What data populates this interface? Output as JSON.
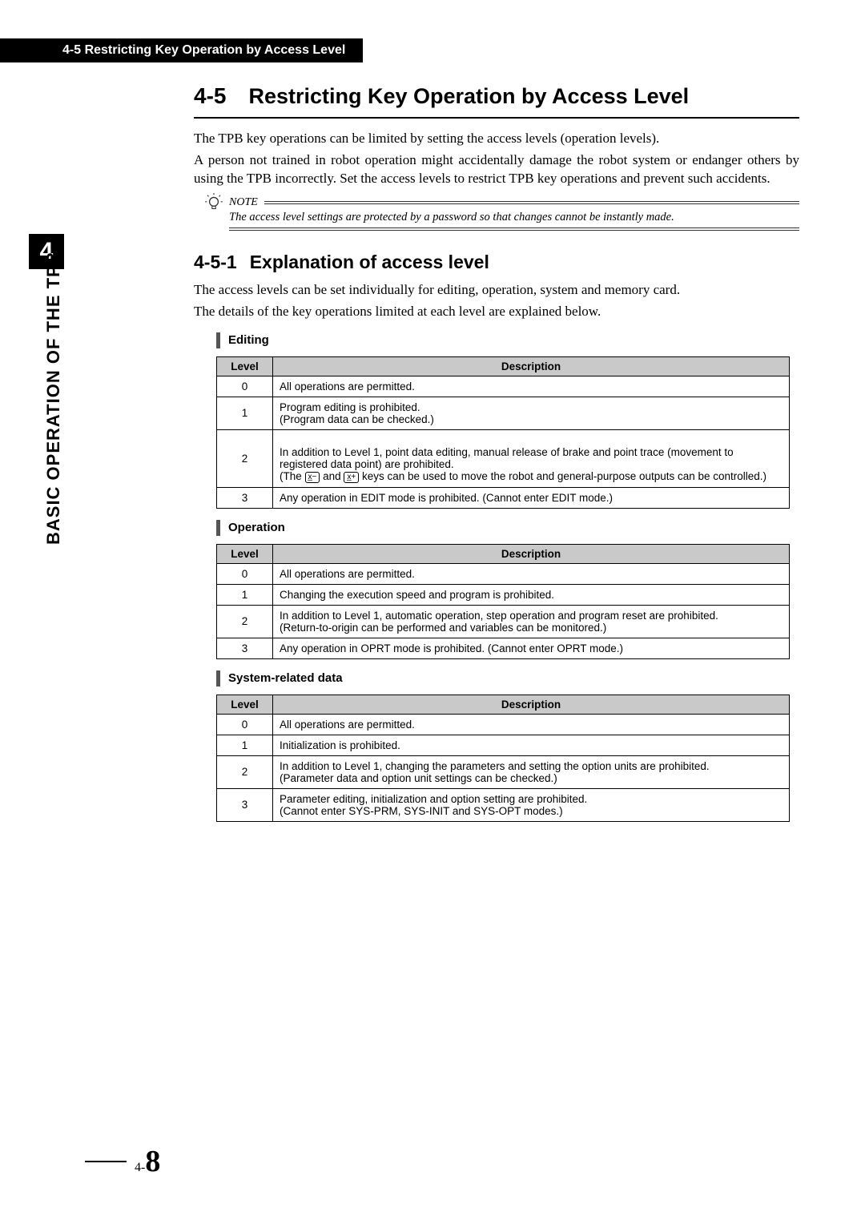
{
  "header": {
    "breadcrumb": "4-5 Restricting Key Operation by Access Level"
  },
  "chapter": {
    "number": "4",
    "side_label": "BASIC OPERATION OF THE TPB"
  },
  "heading": {
    "number": "4-5",
    "title": "Restricting Key Operation by Access Level"
  },
  "intro": {
    "p1": "The TPB key operations can be limited by setting the access levels (operation levels).",
    "p2": "A person not trained in robot operation might accidentally damage the robot system or endanger others by using the TPB incorrectly. Set the access levels to restrict TPB key operations and prevent such accidents."
  },
  "note": {
    "label": "NOTE",
    "text": "The access level settings are protected by a password so that changes cannot be instantly made."
  },
  "sub_heading": {
    "number": "4-5-1",
    "title": "Explanation of access level"
  },
  "sub_intro": {
    "p1": "The access levels can be set individually for editing, operation, system and memory card.",
    "p2": "The details of the key operations limited at each level are explained below."
  },
  "tables": {
    "level_header": "Level",
    "desc_header": "Description",
    "editing": {
      "title": "Editing",
      "rows": [
        {
          "level": "0",
          "desc": "All operations are permitted."
        },
        {
          "level": "1",
          "desc": "Program editing is prohibited.\n(Program data can be checked.)"
        },
        {
          "level": "2",
          "desc_pre": "In addition to Level 1, point data editing, manual release of brake and point trace (movement to registered data point) are prohibited.\n(The ",
          "key1": "x̲−",
          "desc_mid": " and ",
          "key2": "x̲+",
          "desc_post": " keys can be used to move the robot and general-purpose outputs can be controlled.)"
        },
        {
          "level": "3",
          "desc": "Any operation in EDIT mode is prohibited. (Cannot enter EDIT mode.)"
        }
      ]
    },
    "operation": {
      "title": "Operation",
      "rows": [
        {
          "level": "0",
          "desc": "All operations are permitted."
        },
        {
          "level": "1",
          "desc": "Changing the execution speed and program is prohibited."
        },
        {
          "level": "2",
          "desc": "In addition to Level 1, automatic operation, step operation and program reset are prohibited.\n(Return-to-origin can be performed and variables can be monitored.)"
        },
        {
          "level": "3",
          "desc": "Any operation in OPRT mode is prohibited. (Cannot enter OPRT mode.)"
        }
      ]
    },
    "system": {
      "title": "System-related data",
      "rows": [
        {
          "level": "0",
          "desc": "All operations are permitted."
        },
        {
          "level": "1",
          "desc": "Initialization is prohibited."
        },
        {
          "level": "2",
          "desc": "In addition to Level 1, changing the parameters and setting the option units are prohibited.\n(Parameter data and option unit settings can be checked.)"
        },
        {
          "level": "3",
          "desc": "Parameter editing, initialization and option setting are prohibited.\n(Cannot enter SYS-PRM, SYS-INIT and SYS-OPT modes.)"
        }
      ]
    }
  },
  "page_number": {
    "prefix": "4-",
    "num": "8"
  }
}
